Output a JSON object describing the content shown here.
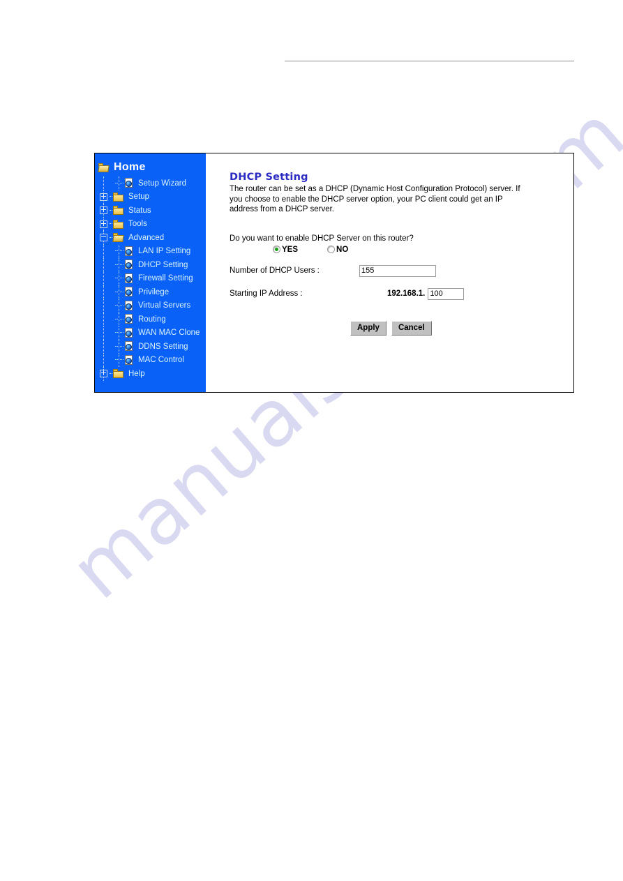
{
  "watermark": {
    "text": "manualshive.com"
  },
  "sidebar": {
    "home": {
      "label": "Home",
      "icon": "open-folder-icon"
    },
    "items": [
      {
        "label": "Setup Wizard",
        "level": 2,
        "icon": "page-globe-icon",
        "expander": "none"
      },
      {
        "label": "Setup",
        "level": 1,
        "icon": "folder-icon",
        "expander": "plus"
      },
      {
        "label": "Status",
        "level": 1,
        "icon": "folder-icon",
        "expander": "plus"
      },
      {
        "label": "Tools",
        "level": 1,
        "icon": "folder-icon",
        "expander": "plus"
      },
      {
        "label": "Advanced",
        "level": 1,
        "icon": "open-folder-icon",
        "expander": "minus"
      },
      {
        "label": "LAN IP Setting",
        "level": 2,
        "icon": "page-globe-icon",
        "expander": "none"
      },
      {
        "label": "DHCP Setting",
        "level": 2,
        "icon": "page-globe-icon",
        "expander": "none"
      },
      {
        "label": "Firewall Setting",
        "level": 2,
        "icon": "page-globe-icon",
        "expander": "none"
      },
      {
        "label": "Privilege",
        "level": 2,
        "icon": "page-globe-icon",
        "expander": "none"
      },
      {
        "label": "Virtual Servers",
        "level": 2,
        "icon": "page-globe-icon",
        "expander": "none"
      },
      {
        "label": "Routing",
        "level": 2,
        "icon": "page-globe-icon",
        "expander": "none"
      },
      {
        "label": "WAN MAC Clone",
        "level": 2,
        "icon": "page-globe-icon",
        "expander": "none"
      },
      {
        "label": "DDNS Setting",
        "level": 2,
        "icon": "page-globe-icon",
        "expander": "none"
      },
      {
        "label": "MAC Control",
        "level": 2,
        "icon": "page-globe-icon",
        "expander": "none"
      },
      {
        "label": "Help",
        "level": 1,
        "icon": "folder-icon",
        "expander": "plus"
      }
    ]
  },
  "main": {
    "heading": "DHCP Setting",
    "description": "The router can be set as a DHCP (Dynamic Host Configuration Protocol) server. If you choose to enable the DHCP server option, your PC client could get an IP address from a DHCP server.",
    "enable_question": "Do you want to enable DHCP Server on this router?",
    "radios": [
      {
        "label": "YES",
        "selected": true
      },
      {
        "label": "NO",
        "selected": false
      }
    ],
    "fields": {
      "dhcp_users_label": "Number of DHCP Users :",
      "dhcp_users_value": "155",
      "start_ip_label": "Starting IP Address :",
      "start_ip_prefix": "192.168.1.",
      "start_ip_value": "100"
    },
    "buttons": {
      "apply": "Apply",
      "cancel": "Cancel"
    }
  },
  "colors": {
    "sidebar_bg": "#0a61f7",
    "heading": "#2b2bc4",
    "radio_dot": "#18a018",
    "watermark": "#d9d9f2"
  }
}
